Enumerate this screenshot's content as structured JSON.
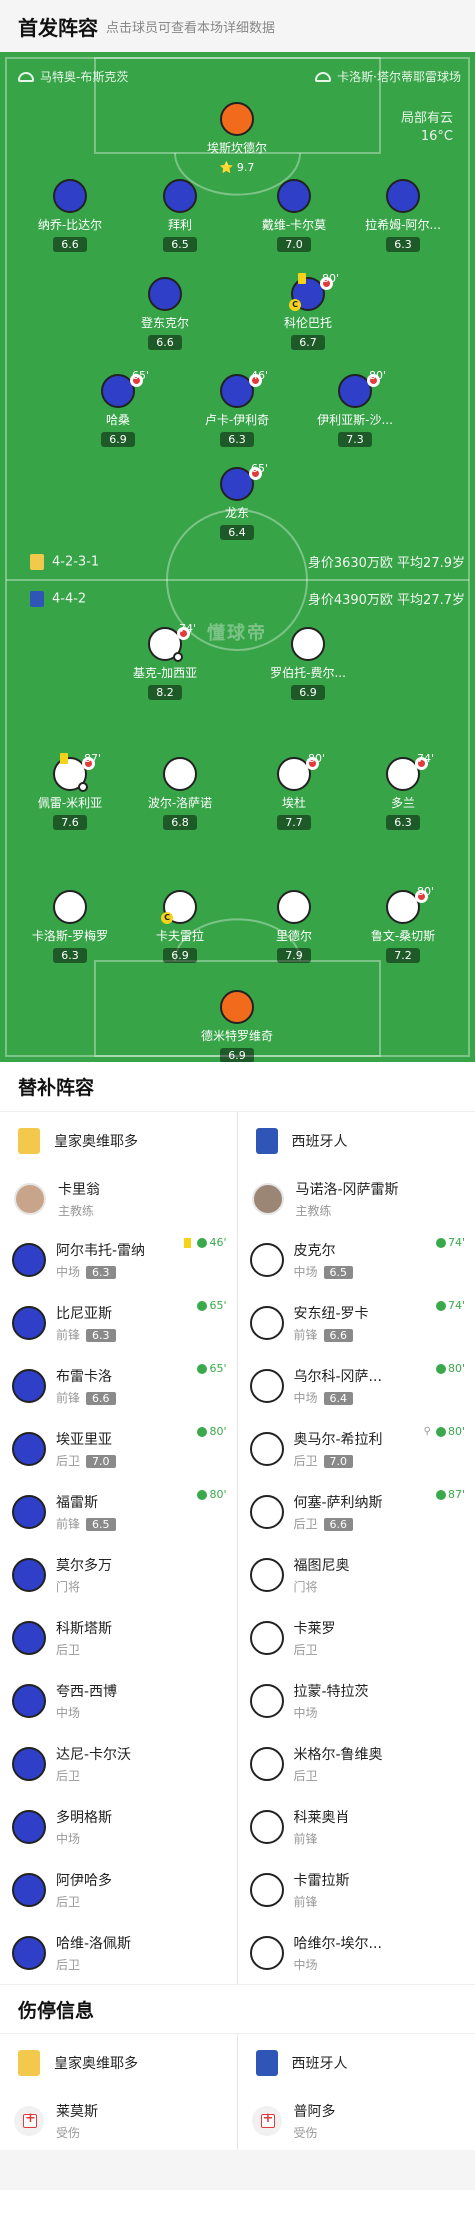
{
  "header": {
    "title": "首发阵容",
    "subtitle": "点击球员可查看本场详细数据"
  },
  "pitch": {
    "venue_left": "马特奥-布斯克茨",
    "venue_right": "卡洛斯·塔尔蒂耶雷球场",
    "weather": "局部有云",
    "temperature": "16°C",
    "watermark": "懂球帝",
    "home_formation": "4-2-3-1",
    "home_value": "身价3630万欧 平均27.9岁",
    "away_formation": "4-4-2",
    "away_value": "身价4390万欧 平均27.7岁",
    "home_players": [
      {
        "name": "埃斯坎德尔",
        "rating": "9.7",
        "star": true
      },
      {
        "name": "纳乔-比达尔",
        "rating": "6.6"
      },
      {
        "name": "拜利",
        "rating": "6.5"
      },
      {
        "name": "戴维-卡尔莫",
        "rating": "7.0"
      },
      {
        "name": "拉希姆-阿尔...",
        "rating": "6.3"
      },
      {
        "name": "登东克尔",
        "rating": "6.6"
      },
      {
        "name": "科伦巴托",
        "rating": "6.7",
        "sub": "80'"
      },
      {
        "name": "哈桑",
        "rating": "6.9",
        "sub": "65'"
      },
      {
        "name": "卢卡-伊利奇",
        "rating": "6.3",
        "sub": "46'"
      },
      {
        "name": "伊利亚斯-沙...",
        "rating": "7.3",
        "sub": "80'"
      },
      {
        "name": "龙东",
        "rating": "6.4",
        "sub": "65'"
      }
    ],
    "away_players": [
      {
        "name": "基克-加西亚",
        "rating": "8.2",
        "sub": "74'"
      },
      {
        "name": "罗伯托-费尔...",
        "rating": "6.9"
      },
      {
        "name": "佩雷-米利亚",
        "rating": "7.6",
        "sub": "87'"
      },
      {
        "name": "波尔-洛萨诺",
        "rating": "6.8"
      },
      {
        "name": "埃杜",
        "rating": "7.7",
        "sub": "80'"
      },
      {
        "name": "多兰",
        "rating": "6.3",
        "sub": "74'"
      },
      {
        "name": "卡洛斯-罗梅罗",
        "rating": "6.3"
      },
      {
        "name": "卡夫雷拉",
        "rating": "6.9"
      },
      {
        "name": "里德尔",
        "rating": "7.9"
      },
      {
        "name": "鲁文-桑切斯",
        "rating": "7.2",
        "sub": "80'"
      },
      {
        "name": "德米特罗维奇",
        "rating": "6.9"
      }
    ]
  },
  "subs": {
    "title": "替补阵容",
    "home_team": "皇家奥维耶多",
    "away_team": "西班牙人",
    "home_coach": {
      "name": "卡里翁",
      "role": "主教练"
    },
    "away_coach": {
      "name": "马诺洛-冈萨雷斯",
      "role": "主教练"
    },
    "home": [
      {
        "name": "阿尔韦托-雷纳",
        "pos": "中场",
        "rating": "6.3",
        "in": "46'",
        "yellow": true
      },
      {
        "name": "比尼亚斯",
        "pos": "前锋",
        "rating": "6.3",
        "in": "65'"
      },
      {
        "name": "布雷卡洛",
        "pos": "前锋",
        "rating": "6.6",
        "in": "65'"
      },
      {
        "name": "埃亚里亚",
        "pos": "后卫",
        "rating": "7.0",
        "in": "80'"
      },
      {
        "name": "福雷斯",
        "pos": "前锋",
        "rating": "6.5",
        "in": "80'"
      },
      {
        "name": "莫尔多万",
        "pos": "门将"
      },
      {
        "name": "科斯塔斯",
        "pos": "后卫"
      },
      {
        "name": "夸西-西博",
        "pos": "中场"
      },
      {
        "name": "达尼-卡尔沃",
        "pos": "后卫"
      },
      {
        "name": "多明格斯",
        "pos": "中场"
      },
      {
        "name": "阿伊哈多",
        "pos": "后卫"
      },
      {
        "name": "哈维-洛佩斯",
        "pos": "后卫"
      }
    ],
    "away": [
      {
        "name": "皮克尔",
        "pos": "中场",
        "rating": "6.5",
        "in": "74'"
      },
      {
        "name": "安东纽-罗卡",
        "pos": "前锋",
        "rating": "6.6",
        "in": "74'"
      },
      {
        "name": "乌尔科-冈萨...",
        "pos": "中场",
        "rating": "6.4",
        "in": "80'"
      },
      {
        "name": "奥马尔-希拉利",
        "pos": "后卫",
        "rating": "7.0",
        "in": "80'",
        "assist": true
      },
      {
        "name": "何塞-萨利纳斯",
        "pos": "后卫",
        "rating": "6.6",
        "in": "87'"
      },
      {
        "name": "福图尼奥",
        "pos": "门将"
      },
      {
        "name": "卡莱罗",
        "pos": "后卫"
      },
      {
        "name": "拉蒙-特拉茨",
        "pos": "中场"
      },
      {
        "name": "米格尔-鲁维奥",
        "pos": "后卫"
      },
      {
        "name": "科莱奥肖",
        "pos": "前锋"
      },
      {
        "name": "卡雷拉斯",
        "pos": "前锋"
      },
      {
        "name": "哈维尔-埃尔...",
        "pos": "中场"
      }
    ]
  },
  "injuries": {
    "title": "伤停信息",
    "home_team": "皇家奥维耶多",
    "away_team": "西班牙人",
    "home": [
      {
        "name": "莱莫斯",
        "status": "受伤"
      }
    ],
    "away": [
      {
        "name": "普阿多",
        "status": "受伤"
      }
    ]
  },
  "colors": {
    "pitch": "#36a447",
    "home_kit": "#2f3fc7",
    "away_kit": "#ffffff",
    "goalkeeper": "#f26b1d"
  }
}
